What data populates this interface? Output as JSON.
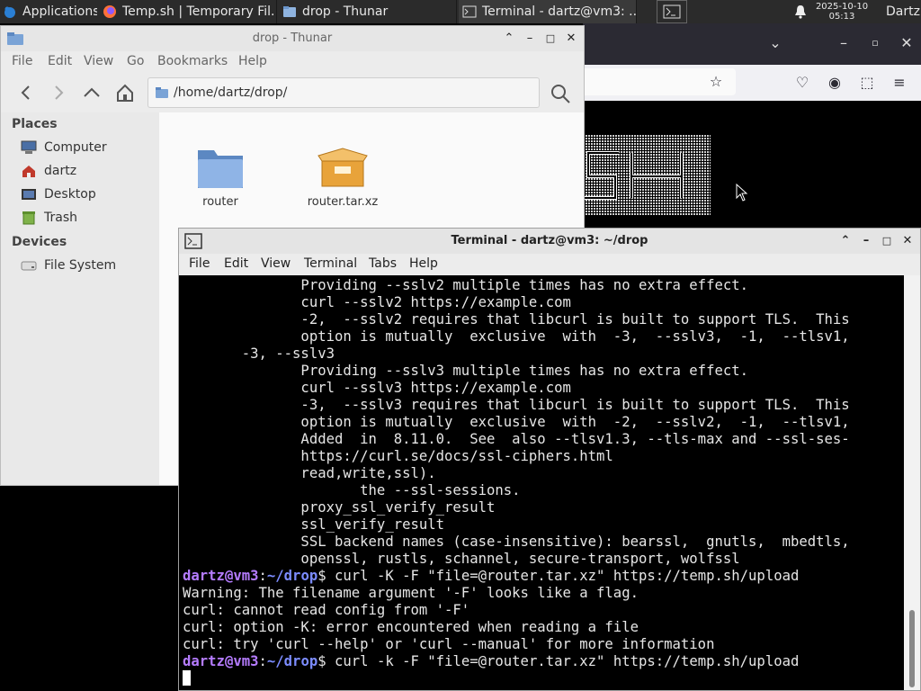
{
  "panel": {
    "apps_label": "Applications",
    "tasks": [
      {
        "label": "Temp.sh | Temporary Fil..."
      },
      {
        "label": "drop - Thunar"
      },
      {
        "label": "Terminal - dartz@vm3: ..."
      }
    ],
    "clock_date": "2025-10-10",
    "clock_time": "05:13",
    "user": "Dartz"
  },
  "thunar": {
    "title": "drop - Thunar",
    "menu": [
      "File",
      "Edit",
      "View",
      "Go",
      "Bookmarks",
      "Help"
    ],
    "path": "/home/dartz/drop/",
    "places_heading": "Places",
    "places": [
      "Computer",
      "dartz",
      "Desktop",
      "Trash"
    ],
    "devices_heading": "Devices",
    "devices": [
      "File System"
    ],
    "files": [
      {
        "name": "router",
        "icon": "folder-icon"
      },
      {
        "name": "router.tar.xz",
        "icon": "archive-icon"
      }
    ]
  },
  "terminal": {
    "title": "Terminal - dartz@vm3: ~/drop",
    "menu": [
      "File",
      "Edit",
      "View",
      "Terminal",
      "Tabs",
      "Help"
    ],
    "lines": [
      "              Providing --sslv2 multiple times has no extra effect.",
      "              curl --sslv2 https://example.com",
      "              -2,  --sslv2 requires that libcurl is built to support TLS.  This",
      "              option is mutually  exclusive  with  -3,  --sslv3,  -1,  --tlsv1,",
      "       -3, --sslv3",
      "              Providing --sslv3 multiple times has no extra effect.",
      "              curl --sslv3 https://example.com",
      "              -3,  --sslv3 requires that libcurl is built to support TLS.  This",
      "              option is mutually  exclusive  with  -2,  --sslv2,  -1,  --tlsv1,",
      "              Added  in  8.11.0.  See  also --tlsv1.3, --tls-max and --ssl-ses-",
      "              https://curl.se/docs/ssl-ciphers.html",
      "              read,write,ssl).",
      "                     the --ssl-sessions.",
      "              proxy_ssl_verify_result",
      "              ssl_verify_result",
      "              SSL backend names (case-insensitive): bearssl,  gnutls,  mbedtls,",
      "              openssl, rustls, schannel, secure-transport, wolfssl"
    ],
    "prompt_user": "dartz@vm3",
    "prompt_sep": ":",
    "prompt_path": "~/drop",
    "prompt_end": "$",
    "cmd1": " curl -K -F \"file=@router.tar.xz\" https://temp.sh/upload",
    "out1": "Warning: The filename argument '-F' looks like a flag.",
    "out2": "curl: cannot read config from '-F'",
    "out3": "curl: option -K: error encountered when reading a file",
    "out4": "curl: try 'curl --help' or 'curl --manual' for more information",
    "cmd2": " curl -k -F \"file=@router.tar.xz\" https://temp.sh/upload"
  },
  "colors": {
    "terminal_bg": "#000000",
    "prompt_user": "#b57cff",
    "prompt_path": "#7c8cff"
  }
}
